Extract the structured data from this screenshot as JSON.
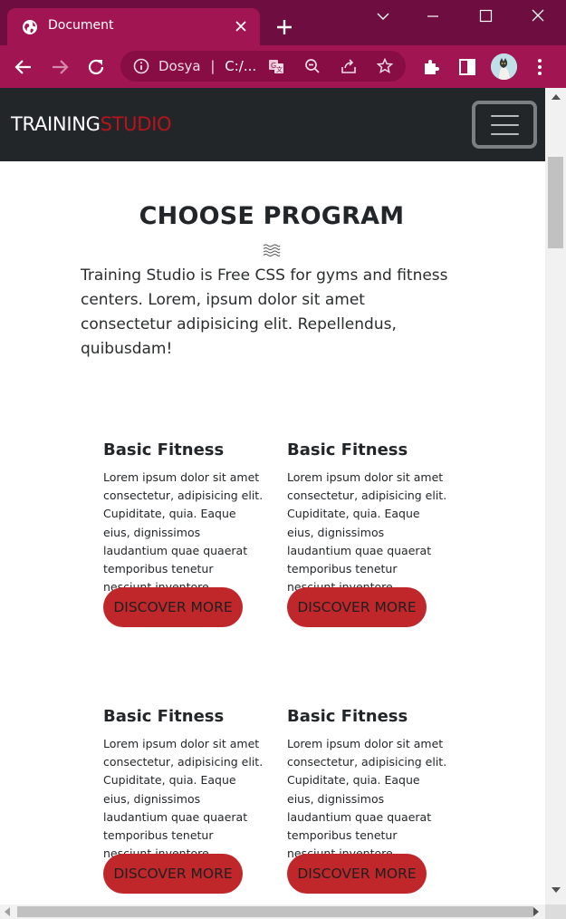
{
  "browser": {
    "tab_title": "Document",
    "address_scheme": "Dosya",
    "address_path": "C:/...",
    "colors": {
      "titlebar": "#6e0d3f",
      "toolbar": "#a01552",
      "omnibox": "#870d44"
    },
    "icons": [
      "globe-icon",
      "close-icon",
      "plus-icon",
      "minimize-icon",
      "maximize-icon",
      "window-close-icon",
      "back-icon",
      "forward-icon",
      "reload-icon",
      "info-icon",
      "translate-icon",
      "zoom-out-icon",
      "share-icon",
      "star-icon",
      "extensions-icon",
      "sidebar-icon",
      "profile-avatar",
      "menu-dots-icon"
    ]
  },
  "site": {
    "logo_part1": "TRAINING",
    "logo_part2": "STUDIO",
    "colors": {
      "header": "#232629",
      "accent": "#b8141b",
      "button": "#c0272b"
    }
  },
  "section": {
    "title": "CHOOSE PROGRAM",
    "intro": "Training Studio is Free CSS for gyms and fitness centers. Lorem, ipsum dolor sit amet consectetur adipisicing elit. Repellendus, quibusdam!"
  },
  "programs": [
    {
      "title": "Basic Fitness",
      "text": "Lorem ipsum dolor sit amet consectetur, adipisicing elit. Cupiditate, quia. Eaque eius, dignissimos laudantium quae quaerat temporibus tenetur nesciunt inventore.",
      "button": "DISCOVER MORE"
    },
    {
      "title": "Basic Fitness",
      "text": "Lorem ipsum dolor sit amet consectetur, adipisicing elit. Cupiditate, quia. Eaque eius, dignissimos laudantium quae quaerat temporibus tenetur nesciunt inventore.",
      "button": "DISCOVER MORE"
    },
    {
      "title": "Basic Fitness",
      "text": "Lorem ipsum dolor sit amet consectetur, adipisicing elit. Cupiditate, quia. Eaque eius, dignissimos laudantium quae quaerat temporibus tenetur nesciunt inventore.",
      "button": "DISCOVER MORE"
    },
    {
      "title": "Basic Fitness",
      "text": "Lorem ipsum dolor sit amet consectetur, adipisicing elit. Cupiditate, quia. Eaque eius, dignissimos laudantium quae quaerat temporibus tenetur nesciunt inventore.",
      "button": "DISCOVER MORE"
    }
  ]
}
